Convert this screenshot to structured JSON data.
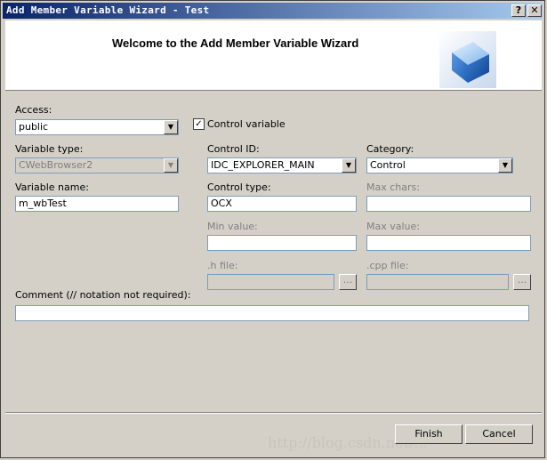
{
  "window": {
    "title": "Add Member Variable Wizard - Test",
    "help_label": "?",
    "close_label": "✕"
  },
  "header": {
    "title": "Welcome to the Add Member Variable Wizard",
    "icon": "cube-icon"
  },
  "form": {
    "access": {
      "label": "Access:",
      "value": "public"
    },
    "control_variable": {
      "label": "Control variable",
      "checked": true
    },
    "variable_type": {
      "label": "Variable type:",
      "value": "CWebBrowser2"
    },
    "control_id": {
      "label": "Control ID:",
      "value": "IDC_EXPLORER_MAIN"
    },
    "category": {
      "label": "Category:",
      "value": "Control"
    },
    "variable_name": {
      "label": "Variable name:",
      "value": "m_wbTest"
    },
    "control_type": {
      "label": "Control type:",
      "value": "OCX"
    },
    "max_chars": {
      "label": "Max chars:",
      "value": ""
    },
    "min_value": {
      "label": "Min value:",
      "value": ""
    },
    "max_value": {
      "label": "Max value:",
      "value": ""
    },
    "h_file": {
      "label": ".h file:",
      "value": "",
      "browse_label": "..."
    },
    "cpp_file": {
      "label": ".cpp file:",
      "value": "",
      "browse_label": "..."
    },
    "comment": {
      "label": "Comment (// notation not required):",
      "value": ""
    }
  },
  "buttons": {
    "finish": "Finish",
    "cancel": "Cancel"
  },
  "watermark": "http://blog.csdn.net/...",
  "colors": {
    "titlebar_start": "#0a246a",
    "titlebar_end": "#a6caf0",
    "dialog_bg": "#d4d0c8",
    "disabled_text": "#808080"
  }
}
